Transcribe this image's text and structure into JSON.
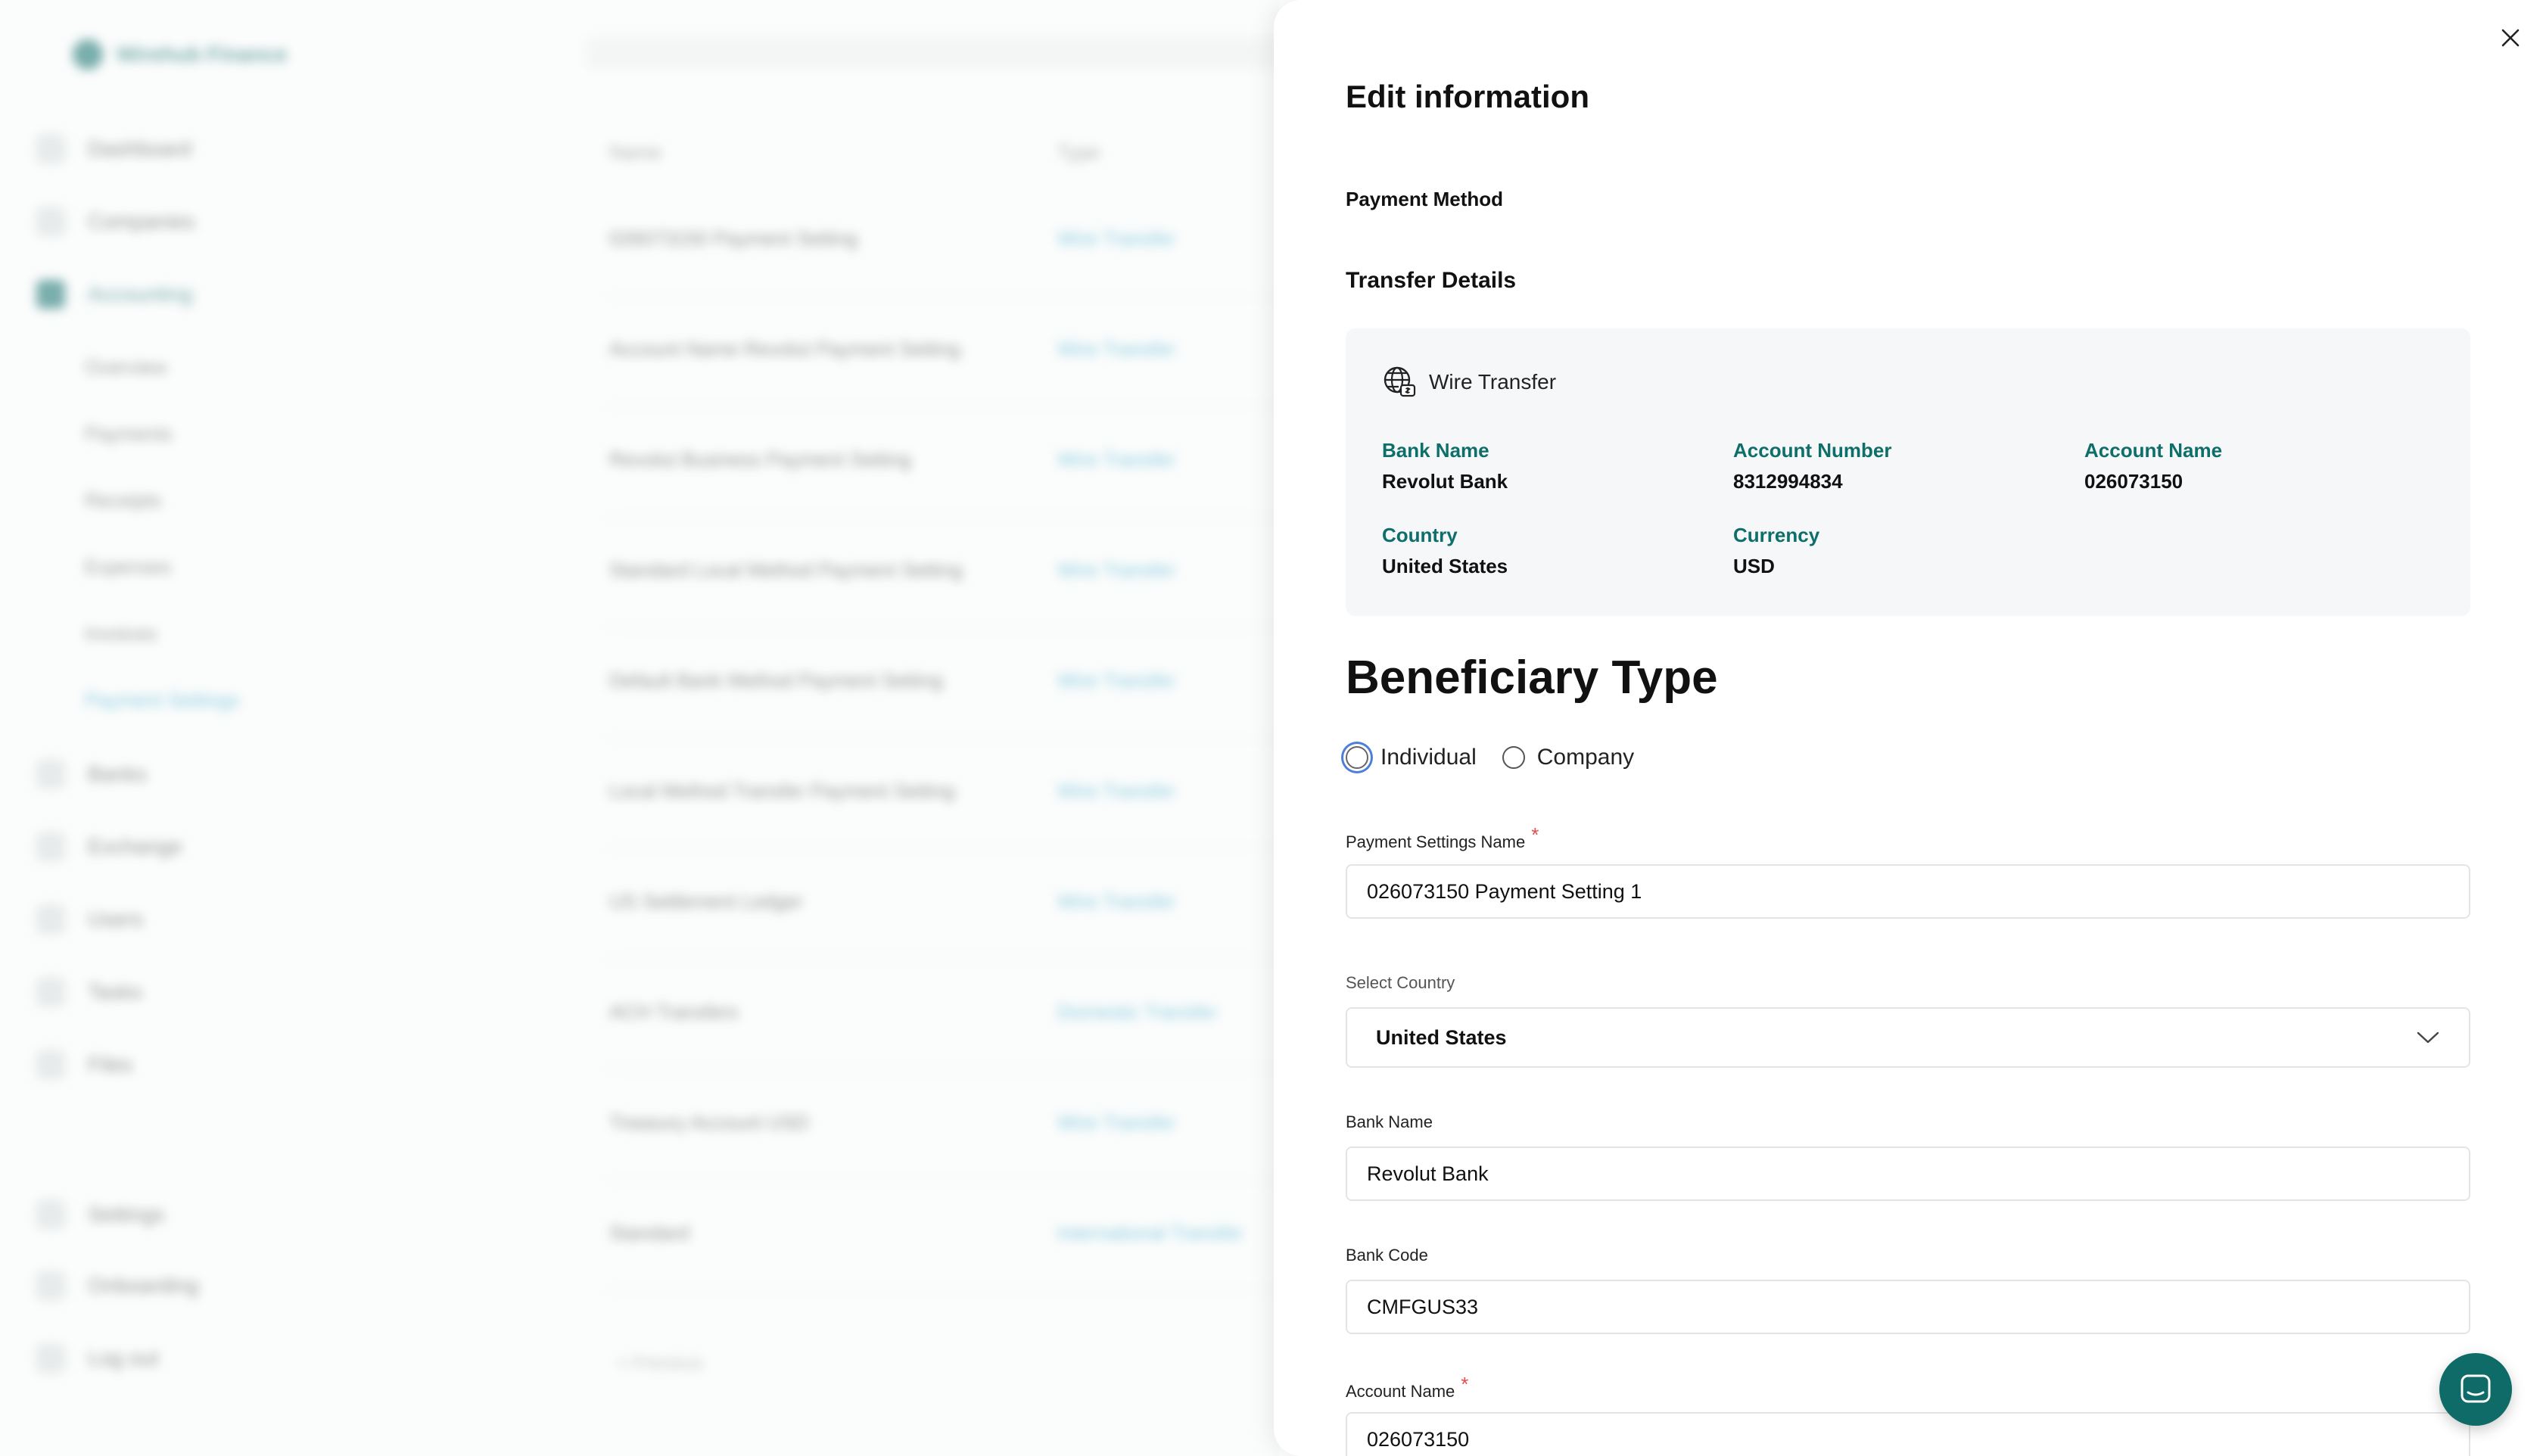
{
  "background": {
    "brand": "Wirehub Finance",
    "nav": [
      {
        "label": "Dashboard"
      },
      {
        "label": "Companies"
      },
      {
        "label": "Accounting"
      },
      {
        "label": "Banks"
      },
      {
        "label": "Exchange"
      },
      {
        "label": "Users"
      },
      {
        "label": "Tasks"
      },
      {
        "label": "Files"
      }
    ],
    "subnav": [
      {
        "label": "Overview"
      },
      {
        "label": "Payments"
      },
      {
        "label": "Receipts"
      },
      {
        "label": "Expenses"
      },
      {
        "label": "Invoices"
      },
      {
        "label": "Payment Settings"
      }
    ],
    "bottom_nav": [
      {
        "label": "Settings"
      },
      {
        "label": "Onboarding"
      },
      {
        "label": "Log out"
      }
    ],
    "columns": [
      "Name",
      "Type"
    ],
    "rows": [
      {
        "name": "026073150 Payment Setting",
        "type": "Wire Transfer"
      },
      {
        "name": "Account Name Revolut Payment Setting",
        "type": "Wire Transfer"
      },
      {
        "name": "Revolut Business Payment Setting",
        "type": "Wire Transfer"
      },
      {
        "name": "Standard Local Method Payment Setting",
        "type": "Wire Transfer"
      },
      {
        "name": "Default Bank Method Payment Setting",
        "type": "Wire Transfer"
      },
      {
        "name": "Local Method Transfer Payment Setting",
        "type": "Wire Transfer"
      },
      {
        "name": "US Settlement Ledger",
        "type": "Wire Transfer"
      },
      {
        "name": "ACH Transfers",
        "type": "Domestic Transfer"
      },
      {
        "name": "Treasury Account USD",
        "type": "Wire Transfer"
      },
      {
        "name": "Standard",
        "type": "International Transfer"
      }
    ],
    "footer": "< Previous"
  },
  "drawer": {
    "title": "Edit information",
    "payment_method_label": "Payment Method",
    "transfer_details_label": "Transfer Details",
    "transfer": {
      "type_label": "Wire Transfer",
      "type_icon": "globe-dollar-icon",
      "fields": [
        {
          "key": "Bank Name",
          "value": "Revolut Bank"
        },
        {
          "key": "Account Number",
          "value": "8312994834"
        },
        {
          "key": "Account Name",
          "value": "026073150"
        },
        {
          "key": "Country",
          "value": "United States"
        },
        {
          "key": "Currency",
          "value": "USD"
        }
      ]
    },
    "beneficiary": {
      "title": "Beneficiary Type",
      "options": [
        {
          "label": "Individual"
        },
        {
          "label": "Company"
        }
      ]
    },
    "form": {
      "payment_settings_name": {
        "label": "Payment Settings Name",
        "required_mark": "*",
        "value": "026073150 Payment Setting 1"
      },
      "country": {
        "label": "Select Country",
        "value": "United States"
      },
      "bank_name": {
        "label": "Bank Name",
        "value": "Revolut Bank"
      },
      "bank_code": {
        "label": "Bank Code",
        "value": "CMFGUS33"
      },
      "account_name": {
        "label": "Account Name",
        "required_mark": "*",
        "value": "026073150"
      }
    }
  },
  "colors": {
    "brand": "#0f6b67",
    "accent_teal": "#0e6e6a",
    "required": "#e34d4d",
    "focus_ring": "#4e7fd8"
  }
}
